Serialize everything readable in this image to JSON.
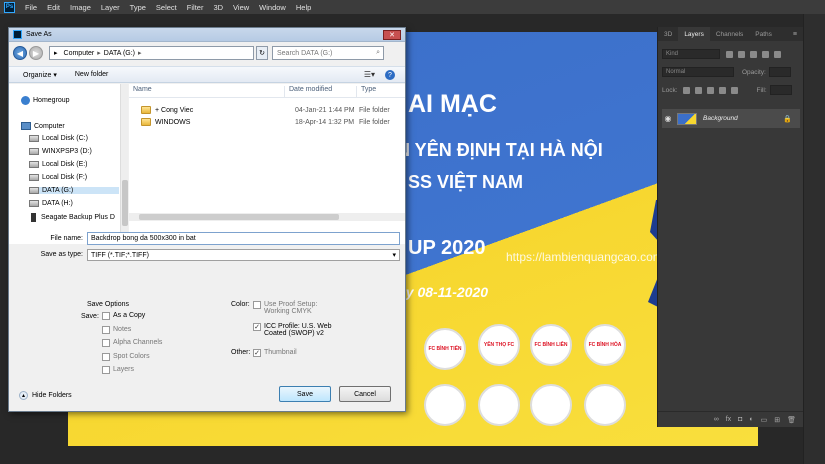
{
  "menubar": {
    "logo": "Ps",
    "items": [
      "File",
      "Edit",
      "Image",
      "Layer",
      "Type",
      "Select",
      "Filter",
      "3D",
      "View",
      "Window",
      "Help"
    ]
  },
  "canvas": {
    "title1": "AI MẠC",
    "title2": "YỆN YÊN ĐỊNH TẠI HÀ NỘI",
    "title3": "SS VIỆT NAM",
    "title4": "UP 2020",
    "title5": "ày 08-11-2020",
    "watermark": "https://lambienquangcao.com.vn",
    "badges": [
      "FC BÌNH TIẾN",
      "YÊN THỌ FC",
      "FC BÌNH LIÊN",
      "FC BÌNH HÒA"
    ]
  },
  "dialog": {
    "title": "Save As",
    "close": "✕",
    "address": {
      "computer": "Computer",
      "drive": "DATA (G:)",
      "search_placeholder": "Search DATA (G:)"
    },
    "toolbar": {
      "organize": "Organize ▾",
      "new_folder": "New folder"
    },
    "nav": {
      "homegroup": "Homegroup",
      "computer": "Computer",
      "drives": [
        "Local Disk (C:)",
        "WINXPSP3 (D:)",
        "Local Disk (E:)",
        "Local Disk (F:)",
        "DATA (G:)",
        "DATA (H:)",
        "Seagate Backup Plus D"
      ]
    },
    "columns": {
      "name": "Name",
      "date": "Date modified",
      "type": "Type"
    },
    "files": [
      {
        "name": "+ Cong Viec",
        "date": "04-Jan-21 1:44 PM",
        "type": "File folder"
      },
      {
        "name": "WINDOWS",
        "date": "18-Apr-14 1:32 PM",
        "type": "File folder"
      }
    ],
    "form": {
      "filename_label": "File name:",
      "filename_value": "Backdrop bong da 500x300 in bat",
      "savetype_label": "Save as type:",
      "savetype_value": "TIFF (*.TIF;*.TIFF)"
    },
    "options": {
      "save_options": "Save Options",
      "save_label": "Save:",
      "as_copy": "As a Copy",
      "notes": "Notes",
      "alpha": "Alpha Channels",
      "spot": "Spot Colors",
      "layers": "Layers",
      "color_label": "Color:",
      "proof_line1": "Use Proof Setup:",
      "proof_line2": "Working CMYK",
      "icc_line1": "ICC Profile:  U.S. Web",
      "icc_line2": "Coated (SWOP) v2",
      "other_label": "Other:",
      "thumbnail": "Thumbnail"
    },
    "hide_folders": "Hide Folders",
    "save_button": "Save",
    "cancel_button": "Cancel"
  },
  "layers_panel": {
    "tabs": [
      "3D",
      "Layers",
      "Channels",
      "Paths"
    ],
    "kind": "Kind",
    "blend_mode": "Normal",
    "opacity_label": "Opacity:",
    "lock_label": "Lock:",
    "fill_label": "Fill:",
    "layer_name": "Background"
  }
}
